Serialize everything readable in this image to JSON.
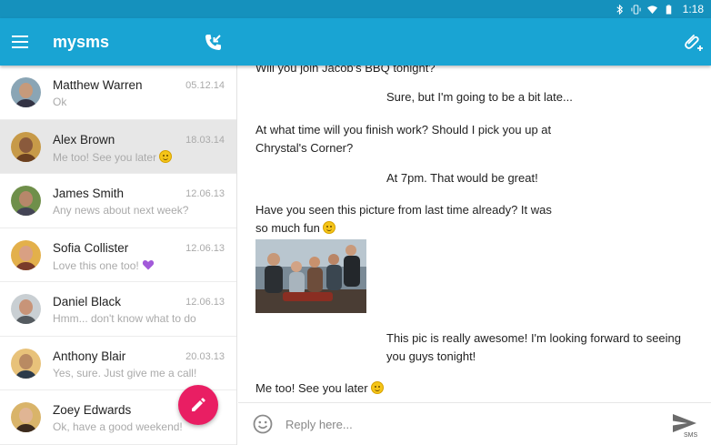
{
  "status_bar": {
    "time": "1:18"
  },
  "app": {
    "title": "mysms"
  },
  "conversations": [
    {
      "name": "Matthew Warren",
      "date": "05.12.14",
      "preview": "Ok",
      "emoji": "",
      "active": false
    },
    {
      "name": "Alex Brown",
      "date": "18.03.14",
      "preview": "Me too! See you later",
      "emoji": "smile",
      "active": true
    },
    {
      "name": "James Smith",
      "date": "12.06.13",
      "preview": "Any news about next week?",
      "emoji": "",
      "active": false
    },
    {
      "name": "Sofia Collister",
      "date": "12.06.13",
      "preview": "Love this one too!",
      "emoji": "purple-heart",
      "active": false
    },
    {
      "name": "Daniel Black",
      "date": "12.06.13",
      "preview": "Hmm... don't know what to do",
      "emoji": "",
      "active": false
    },
    {
      "name": "Anthony Blair",
      "date": "20.03.13",
      "preview": "Yes, sure. Just give me a call!",
      "emoji": "",
      "active": false
    },
    {
      "name": "Zoey Edwards",
      "date": "",
      "preview": "Ok, have a good weekend!",
      "emoji": "",
      "active": false
    }
  ],
  "messages": [
    {
      "direction": "in",
      "text": "Will you join Jacob's BBQ tonight?"
    },
    {
      "direction": "out",
      "text": "Sure, but I'm going to be a bit late..."
    },
    {
      "direction": "in",
      "lines": [
        "At what time will you finish work? Should I pick you up at",
        "Chrystal's Corner?"
      ]
    },
    {
      "direction": "out",
      "text": "At 7pm. That would be great!"
    },
    {
      "direction": "in",
      "lines": [
        "Have you seen this picture from last time already? It was",
        "so much fun"
      ],
      "emoji": "smile"
    },
    {
      "direction": "out",
      "lines": [
        "This pic is really awesome! I'm looking forward to seeing",
        "you guys tonight!"
      ]
    },
    {
      "direction": "in",
      "text": "Me too! See you later",
      "emoji": "smile"
    }
  ],
  "composer": {
    "placeholder": "Reply here...",
    "send_label": "SMS"
  },
  "colors": {
    "appbar": "#19a4d3",
    "statusbar": "#1591bd",
    "fab": "#e91e63",
    "selected_row": "#e7e7e7"
  },
  "icons": [
    "menu-icon",
    "incoming-call-icon",
    "attach-icon",
    "compose-icon",
    "emoji-icon",
    "send-icon"
  ]
}
